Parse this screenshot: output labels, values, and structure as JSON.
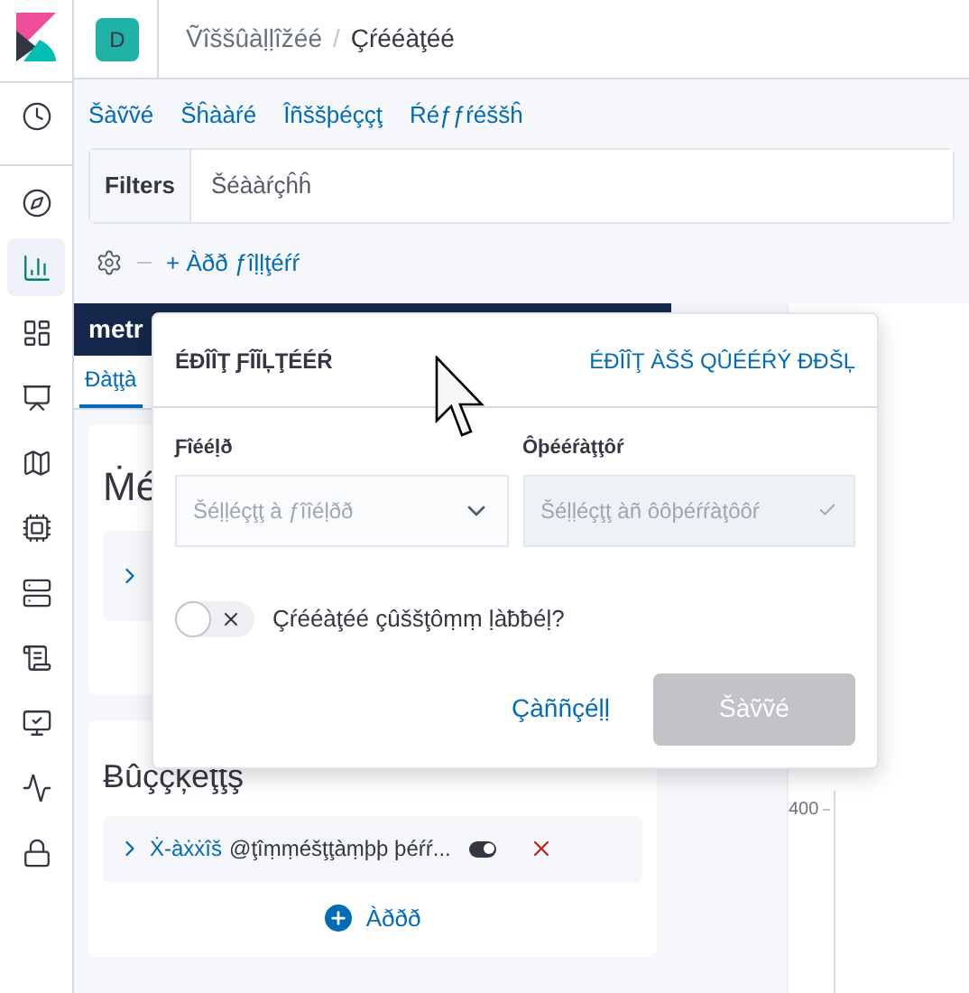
{
  "header": {
    "space_avatar": "D",
    "breadcrumbs": [
      "Ṽîššûàḷḷîžéé",
      "Çŕééàţéé"
    ],
    "separator": "/"
  },
  "nav": [
    {
      "kind": "clock",
      "selected": false
    },
    {
      "kind": "compass",
      "selected": false
    },
    {
      "kind": "chart",
      "selected": true
    },
    {
      "kind": "dashboard",
      "selected": false
    },
    {
      "kind": "canvas",
      "selected": false
    },
    {
      "kind": "map",
      "selected": false
    },
    {
      "kind": "ml",
      "selected": false
    },
    {
      "kind": "infra",
      "selected": false
    },
    {
      "kind": "logs",
      "selected": false
    },
    {
      "kind": "apm",
      "selected": false
    },
    {
      "kind": "uptime",
      "selected": false
    },
    {
      "kind": "lock",
      "selected": false
    }
  ],
  "top_menu": [
    "Šàṽṽé",
    "Šĥààŕé",
    "Îñššþéççţ",
    "Ŕéƒƒŕéššĥ"
  ],
  "filter_bar": {
    "label": "Filters",
    "placeholder": "Šéààŕçĥĥ",
    "add_filter": "+ Àðð ƒîḷḷţéŕŕ"
  },
  "panel": {
    "title": "metr",
    "tabs": [
      {
        "label": "Ðàţţà",
        "selected": true
      }
    ],
    "metrics_title": "Ṁé",
    "buckets_title": "Ƀûççķéţţş",
    "bucket": {
      "name": "Ẋ-àẋẋîš",
      "description": "@ţîṃṃéšţţàṃþþ þéŕŕ...",
      "enabled": true
    },
    "add": "Àððð"
  },
  "chart": {
    "y_tick": "400"
  },
  "popover": {
    "title": "ÉÐÎÎŢ ƑÎĨĻŢÉÉŔ",
    "dsl_link": "ÉÐÎÎŢ ÀŠŠ QÛÉÉŔÝ ÐÐŠĻ",
    "fields": [
      {
        "label": "Ƒîééḷð",
        "placeholder": "Šéḷḷéçţţ à ƒîîéḷðð",
        "disabled": false
      },
      {
        "label": "Ôþééŕàţţôŕ",
        "placeholder": "Šéḷḷéçţţ àñ ôôþéŕŕàţôôŕ",
        "disabled": true
      }
    ],
    "custom_label": {
      "label": "Çŕééàţéé çûššţôṃṃ ḷàƀƀéḷ?",
      "on": false
    },
    "cancel": "Çàññçéḷḷ",
    "save": {
      "label": "Šàṽṽé",
      "disabled": true
    }
  }
}
